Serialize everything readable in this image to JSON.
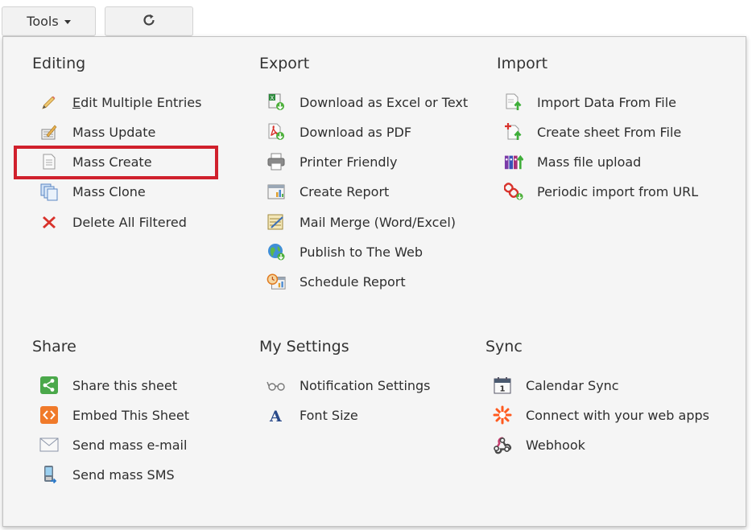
{
  "toolbar": {
    "tools_label": "Tools"
  },
  "sections": {
    "editing": {
      "title": "Editing",
      "items": [
        {
          "prefix": "E",
          "label": "dit Multiple Entries",
          "icon": "pencil-icon"
        },
        {
          "label": "Mass Update",
          "icon": "mass-update-icon"
        },
        {
          "label": "Mass Create",
          "icon": "document-icon"
        },
        {
          "label": "Mass Clone",
          "icon": "clone-icon"
        },
        {
          "label": "Delete All Filtered",
          "icon": "delete-x-icon"
        }
      ]
    },
    "export": {
      "title": "Export",
      "items": [
        {
          "label": "Download as Excel or Text",
          "icon": "excel-download-icon"
        },
        {
          "label": "Download as PDF",
          "icon": "pdf-download-icon"
        },
        {
          "label": "Printer Friendly",
          "icon": "printer-icon"
        },
        {
          "label": "Create Report",
          "icon": "report-icon"
        },
        {
          "label": "Mail Merge (Word/Excel)",
          "icon": "mail-merge-icon"
        },
        {
          "label": "Publish to The Web",
          "icon": "globe-icon"
        },
        {
          "label": "Schedule Report",
          "icon": "schedule-report-icon"
        }
      ]
    },
    "import": {
      "title": "Import",
      "items": [
        {
          "label": "Import Data From File",
          "icon": "import-file-icon"
        },
        {
          "label": "Create sheet From File",
          "icon": "create-sheet-icon"
        },
        {
          "label": "Mass file upload",
          "icon": "mass-upload-icon"
        },
        {
          "label": "Periodic import from URL",
          "icon": "link-chain-icon"
        }
      ]
    },
    "share": {
      "title": "Share",
      "items": [
        {
          "label": "Share this sheet",
          "icon": "share-icon"
        },
        {
          "label": "Embed This Sheet",
          "icon": "embed-code-icon"
        },
        {
          "label": "Send mass e-mail",
          "icon": "envelope-icon"
        },
        {
          "label": "Send mass SMS",
          "icon": "phone-icon"
        }
      ]
    },
    "settings": {
      "title": "My Settings",
      "items": [
        {
          "label": "Notification Settings",
          "icon": "glasses-icon"
        },
        {
          "label": "Font Size",
          "icon": "font-size-icon"
        }
      ]
    },
    "sync": {
      "title": "Sync",
      "items": [
        {
          "label": "Calendar Sync",
          "icon": "calendar-icon"
        },
        {
          "label": "Connect with your web apps",
          "icon": "zapier-star-icon"
        },
        {
          "label": "Webhook",
          "icon": "webhook-icon"
        }
      ]
    }
  }
}
